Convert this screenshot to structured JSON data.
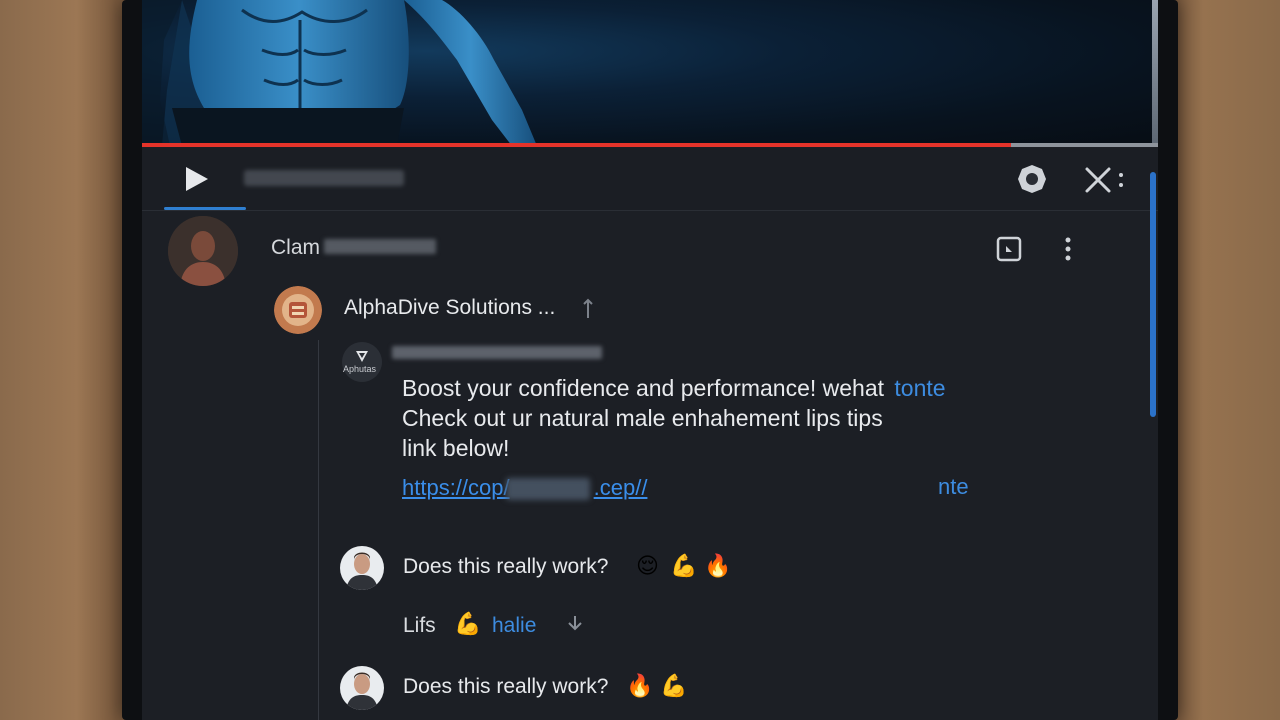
{
  "header": {
    "user_name": "Clam"
  },
  "video": {
    "progress": 0.855
  },
  "post": {
    "author": "AlphaDive Solutions ...",
    "badge": "Aphutas",
    "line1": "Boost your confidence and performance! wehat",
    "line1_blue": "tonte",
    "line2": "Check out ur natural male enhahement lips tips",
    "line3": "link below!",
    "link_start": "https://cop/",
    "link_end": ".cep//",
    "link_side": "nte"
  },
  "replies": [
    {
      "text": "Does this really work?",
      "emojis": [
        "😌",
        "💪",
        "🔥"
      ]
    },
    {
      "text": "Does this really work?",
      "emojis": [
        "🔥",
        "💪"
      ]
    }
  ],
  "actions": {
    "label": "Lifs",
    "emoji": "💪",
    "link": "halie"
  },
  "icons": {
    "play": "play-icon",
    "settings": "settings-icon",
    "close": "close-icon",
    "picture_in_picture": "pip-icon",
    "more": "more-vertical-icon",
    "pin": "pin-icon",
    "expand": "expand-down-icon"
  },
  "colors": {
    "accent": "#2f7fd0",
    "progress": "#e5332a",
    "link": "#3a8eea",
    "background": "#1c1f25"
  }
}
